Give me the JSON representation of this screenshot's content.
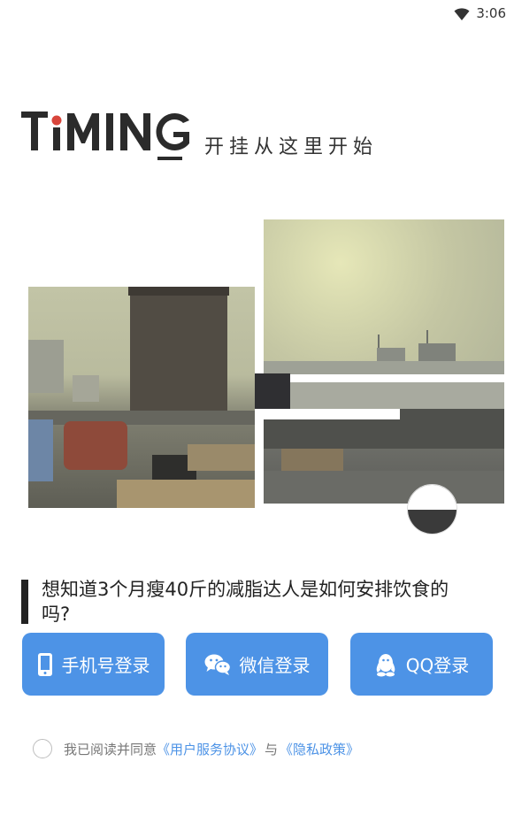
{
  "status_bar": {
    "time": "3:06",
    "wifi_icon": "wifi-icon"
  },
  "logo": {
    "text": "TiMING",
    "accent_color": "#d8453b"
  },
  "slogan": "开挂从这里开始",
  "captcha": {
    "knob_icon": "slider-knob"
  },
  "quote": "想知道3个月瘦40斤的减脂达人是如何安排饮食的吗?",
  "buttons": {
    "phone": {
      "label": "手机号登录",
      "icon": "phone-icon"
    },
    "wechat": {
      "label": "微信登录",
      "icon": "wechat-icon"
    },
    "qq": {
      "label": "QQ登录",
      "icon": "qq-icon"
    }
  },
  "agreement": {
    "prefix": "我已阅读并同意",
    "terms": "《用户服务协议》",
    "joiner": "与",
    "privacy": "《隐私政策》"
  },
  "colors": {
    "primary": "#4d93e6",
    "text": "#222222"
  }
}
